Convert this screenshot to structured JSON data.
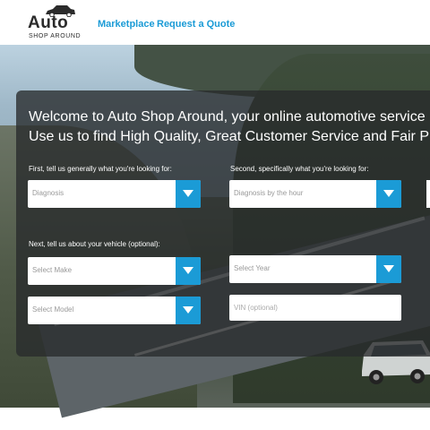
{
  "header": {
    "logo": {
      "word": "Auto",
      "sub": "SHOP AROUND"
    },
    "nav": {
      "marketplace": "Marketplace",
      "request_quote": "Request a Quote"
    }
  },
  "hero": {
    "welcome_line1": "Welcome to Auto Shop Around, your online automotive service r",
    "welcome_line2": "Use us to find High Quality, Great Customer Service and Fair Pric"
  },
  "form": {
    "label_general": "First, tell us generally what you're looking for:",
    "label_specific": "Second, specifically what you're looking for:",
    "label_vehicle": "Next, tell us about your vehicle (optional):",
    "general_value": "Diagnosis",
    "specific_value": "Diagnosis by the hour",
    "make_value": "Select Make",
    "year_value": "Select Year",
    "model_value": "Select Model",
    "vin_placeholder": "VIN (optional)"
  },
  "colors": {
    "accent": "#1b9bd6",
    "overlay": "rgba(40,42,44,0.78)"
  }
}
